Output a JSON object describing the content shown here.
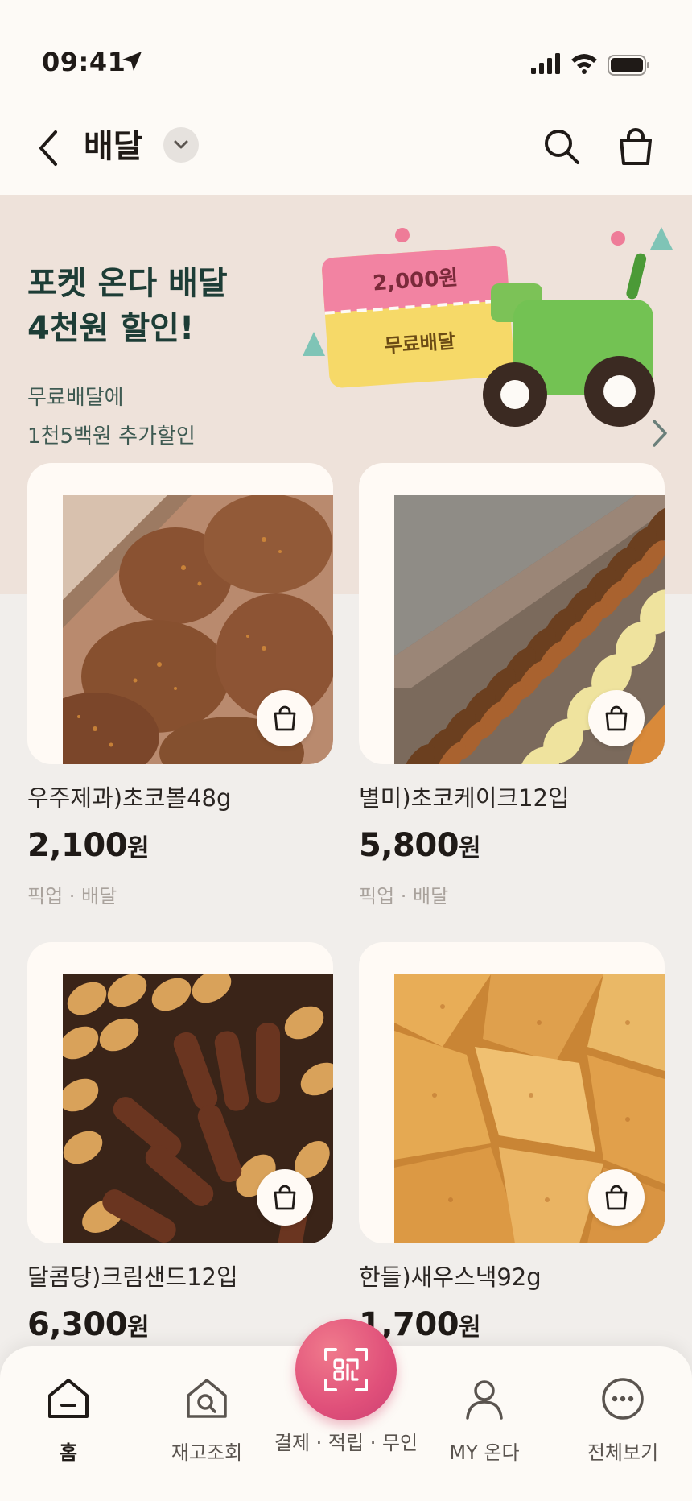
{
  "status_bar": {
    "time": "09:41"
  },
  "header": {
    "title": "배달"
  },
  "banner": {
    "headline_line1": "포켓 온다 배달",
    "headline_line2": "4천원 할인!",
    "sub_line1": "무료배달에",
    "sub_line2": "1천5백원 추가할인",
    "coupon_amount": "2,000원",
    "coupon_free": "무료배달"
  },
  "products": [
    {
      "name": "우주제과)초코볼48g",
      "price": "2,100",
      "unit": "원",
      "tags": "픽업 · 배달"
    },
    {
      "name": "별미)초코케이크12입",
      "price": "5,800",
      "unit": "원",
      "tags": "픽업 · 배달"
    },
    {
      "name": "달콤당)크림샌드12입",
      "price": "6,300",
      "unit": "원",
      "tags": ""
    },
    {
      "name": "한들)새우스낵92g",
      "price": "1,700",
      "unit": "원",
      "tags": ""
    }
  ],
  "bottom_nav": {
    "home": "홈",
    "stock": "재고조회",
    "scan": "결제 · 적립 · 무인",
    "my": "MY 온다",
    "more": "전체보기"
  },
  "colors": {
    "accent_pink": "#e0507a",
    "banner_bg": "#eee2da",
    "headline": "#1d3d36"
  }
}
